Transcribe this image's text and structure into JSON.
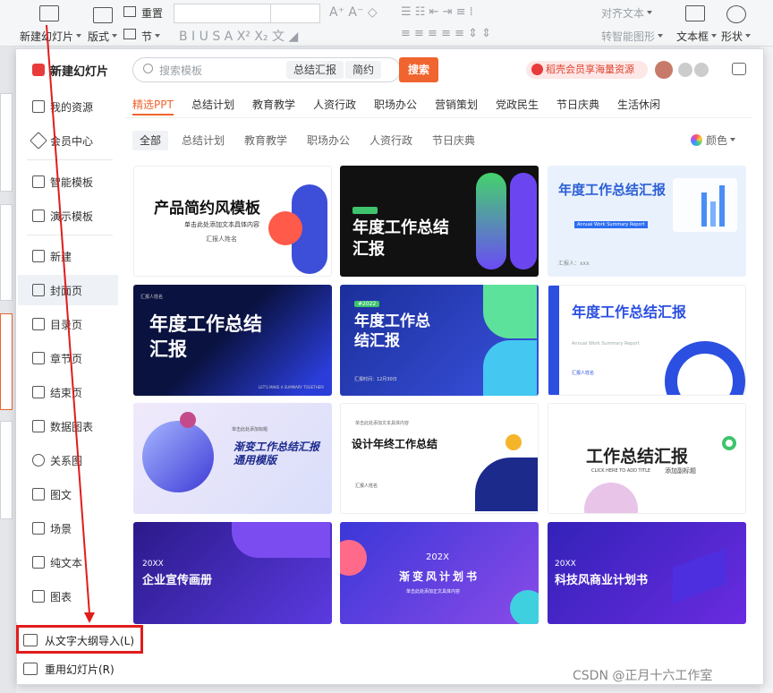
{
  "ribbon": {
    "new_slide": "新建幻灯片",
    "layout": "版式",
    "section": "节",
    "reset": "重置",
    "align_text": "对齐文本",
    "smart_shape": "转智能图形",
    "textbox": "文本框",
    "shape": "形状"
  },
  "sidebar": {
    "header": "新建幻灯片",
    "items": [
      {
        "label": "我的资源",
        "icon": "user-icon"
      },
      {
        "label": "会员中心",
        "icon": "diamond-icon"
      },
      {
        "label": "智能模板",
        "icon": "cube-icon"
      },
      {
        "label": "演示模板",
        "icon": "template-icon"
      },
      {
        "label": "新建",
        "icon": "new-icon"
      },
      {
        "label": "封面页",
        "icon": "cover-icon"
      },
      {
        "label": "目录页",
        "icon": "toc-icon"
      },
      {
        "label": "章节页",
        "icon": "chapter-icon"
      },
      {
        "label": "结束页",
        "icon": "end-icon"
      },
      {
        "label": "数据图表",
        "icon": "chart-icon"
      },
      {
        "label": "关系图",
        "icon": "relation-icon"
      },
      {
        "label": "图文",
        "icon": "image-text-icon"
      },
      {
        "label": "场景",
        "icon": "scene-icon"
      },
      {
        "label": "纯文本",
        "icon": "text-icon"
      },
      {
        "label": "图表",
        "icon": "bar-chart-icon"
      }
    ]
  },
  "search": {
    "placeholder": "搜索模板",
    "tag1": "总结汇报",
    "tag2": "简约",
    "button": "搜索"
  },
  "promo": "稻壳会员享海量资源",
  "tabs": [
    "精选PPT",
    "总结计划",
    "教育教学",
    "人资行政",
    "职场办公",
    "营销策划",
    "党政民生",
    "节日庆典",
    "生活休闲"
  ],
  "filters": [
    "全部",
    "总结计划",
    "教育教学",
    "职场办公",
    "人资行政",
    "节日庆典"
  ],
  "color_label": "颜色",
  "cards": [
    {
      "title": "产品简约风模板",
      "sub": "单击此处添加文本具体内容",
      "sub2": "汇报人姓名"
    },
    {
      "title": "年度工作总结汇报",
      "sub": "",
      "sub2": ""
    },
    {
      "title": "年度工作总结汇报",
      "sub": "Annual Work Summary Report",
      "sub2": "汇报人：xxx"
    },
    {
      "title": "年度工作总结汇报",
      "sub": "汇报人姓名",
      "sub2": "LET'S MAKE A SUMMARY TOGETHER!"
    },
    {
      "title": "年度工作总结汇报",
      "sub": "#2022",
      "sub2": "汇报时间：12月30日"
    },
    {
      "title": "年度工作总结汇报",
      "sub": "Annual Work Summary Report",
      "sub2": "汇报人姓名"
    },
    {
      "title": "渐变工作总结汇报通用模版",
      "sub": "单击此处添加标题",
      "sub2": ""
    },
    {
      "title": "设计年终工作总结",
      "sub": "单击此处添加文本具体内容",
      "sub2": "汇报人姓名"
    },
    {
      "title": "工作总结汇报",
      "sub": "CLICK HERE TO ADD TITLE",
      "sub2": "添加副标题"
    },
    {
      "title": "企业宣传画册",
      "sub": "20XX",
      "sub2": ""
    },
    {
      "title": "渐变风计划书",
      "sub": "202X",
      "sub2": "单击此处添加正文具体内容"
    },
    {
      "title": "科技风商业计划书",
      "sub": "20XX",
      "sub2": ""
    }
  ],
  "bottom": {
    "import_outline": "从文字大纲导入(L)",
    "reuse_slides": "重用幻灯片(R)"
  },
  "watermark": "CSDN @正月十六工作室",
  "colors": {
    "accent": "#f0642f",
    "highlight": "#e11c1c"
  }
}
